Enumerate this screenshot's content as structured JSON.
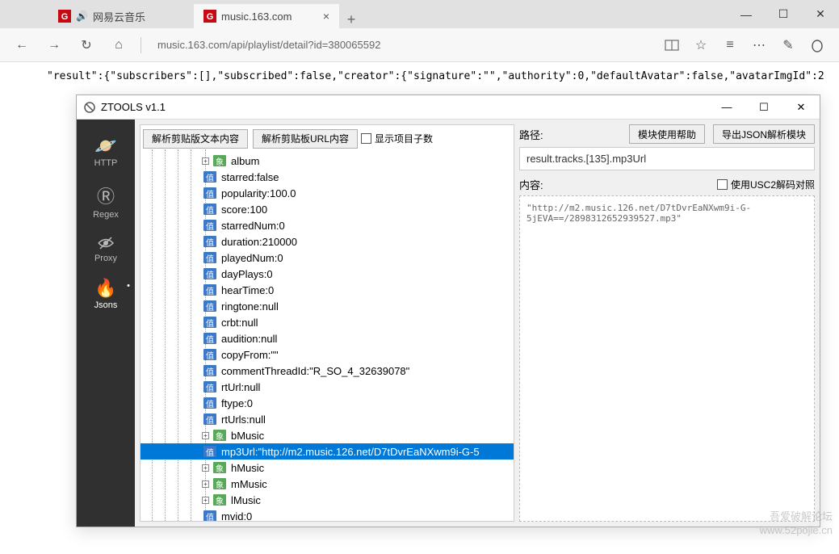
{
  "browser": {
    "tabs": [
      {
        "title": "网易云音乐",
        "icon_color": "#c60a14",
        "sound": true
      },
      {
        "title": "music.163.com",
        "icon_color": "#c60a14"
      }
    ],
    "address": "music.163.com/api/playlist/detail?id=380065592",
    "json_bg": "\"result\":{\"subscribers\":[],\"subscribed\":false,\"creator\":{\"signature\":\"\",\"authority\":0,\"defaultAvatar\":false,\"avatarImgId\":2"
  },
  "ztools": {
    "title": "ZTOOLS  v1.1",
    "sidebar": [
      {
        "label": "HTTP"
      },
      {
        "label": "Regex"
      },
      {
        "label": "Proxy"
      },
      {
        "label": "Jsons"
      }
    ],
    "toolbar": {
      "parse_text": "解析剪贴版文本内容",
      "parse_url": "解析剪贴板URL内容",
      "show_count": "显示项目子数"
    },
    "tree": [
      {
        "type": "obj",
        "label": "album",
        "exp": "+"
      },
      {
        "type": "val",
        "label": "starred:false"
      },
      {
        "type": "val",
        "label": "popularity:100.0"
      },
      {
        "type": "val",
        "label": "score:100"
      },
      {
        "type": "val",
        "label": "starredNum:0"
      },
      {
        "type": "val",
        "label": "duration:210000"
      },
      {
        "type": "val",
        "label": "playedNum:0"
      },
      {
        "type": "val",
        "label": "dayPlays:0"
      },
      {
        "type": "val",
        "label": "hearTime:0"
      },
      {
        "type": "val",
        "label": "ringtone:null"
      },
      {
        "type": "val",
        "label": "crbt:null"
      },
      {
        "type": "val",
        "label": "audition:null"
      },
      {
        "type": "val",
        "label": "copyFrom:\"\""
      },
      {
        "type": "val",
        "label": "commentThreadId:\"R_SO_4_32639078\""
      },
      {
        "type": "val",
        "label": "rtUrl:null"
      },
      {
        "type": "val",
        "label": "ftype:0"
      },
      {
        "type": "val",
        "label": "rtUrls:null"
      },
      {
        "type": "obj",
        "label": "bMusic",
        "exp": "+"
      },
      {
        "type": "val",
        "label": "mp3Url:\"http://m2.music.126.net/D7tDvrEaNXwm9i-G-5",
        "selected": true
      },
      {
        "type": "obj",
        "label": "hMusic",
        "exp": "+"
      },
      {
        "type": "obj",
        "label": "mMusic",
        "exp": "+"
      },
      {
        "type": "obj",
        "label": "lMusic",
        "exp": "+"
      },
      {
        "type": "val",
        "label": "mvid:0"
      }
    ],
    "right": {
      "path_label": "路径:",
      "path_value": "result.tracks.[135].mp3Url",
      "help_btn": "模块使用帮助",
      "export_btn": "导出JSON解析模块",
      "content_label": "内容:",
      "usc2_label": "使用USC2解码对照",
      "content_value": "\"http://m2.music.126.net/D7tDvrEaNXwm9i-G-5jEVA==/2898312652939527.mp3\""
    }
  },
  "watermark": {
    "l1": "吾爱破解论坛",
    "l2": "www.52pojie.cn"
  }
}
